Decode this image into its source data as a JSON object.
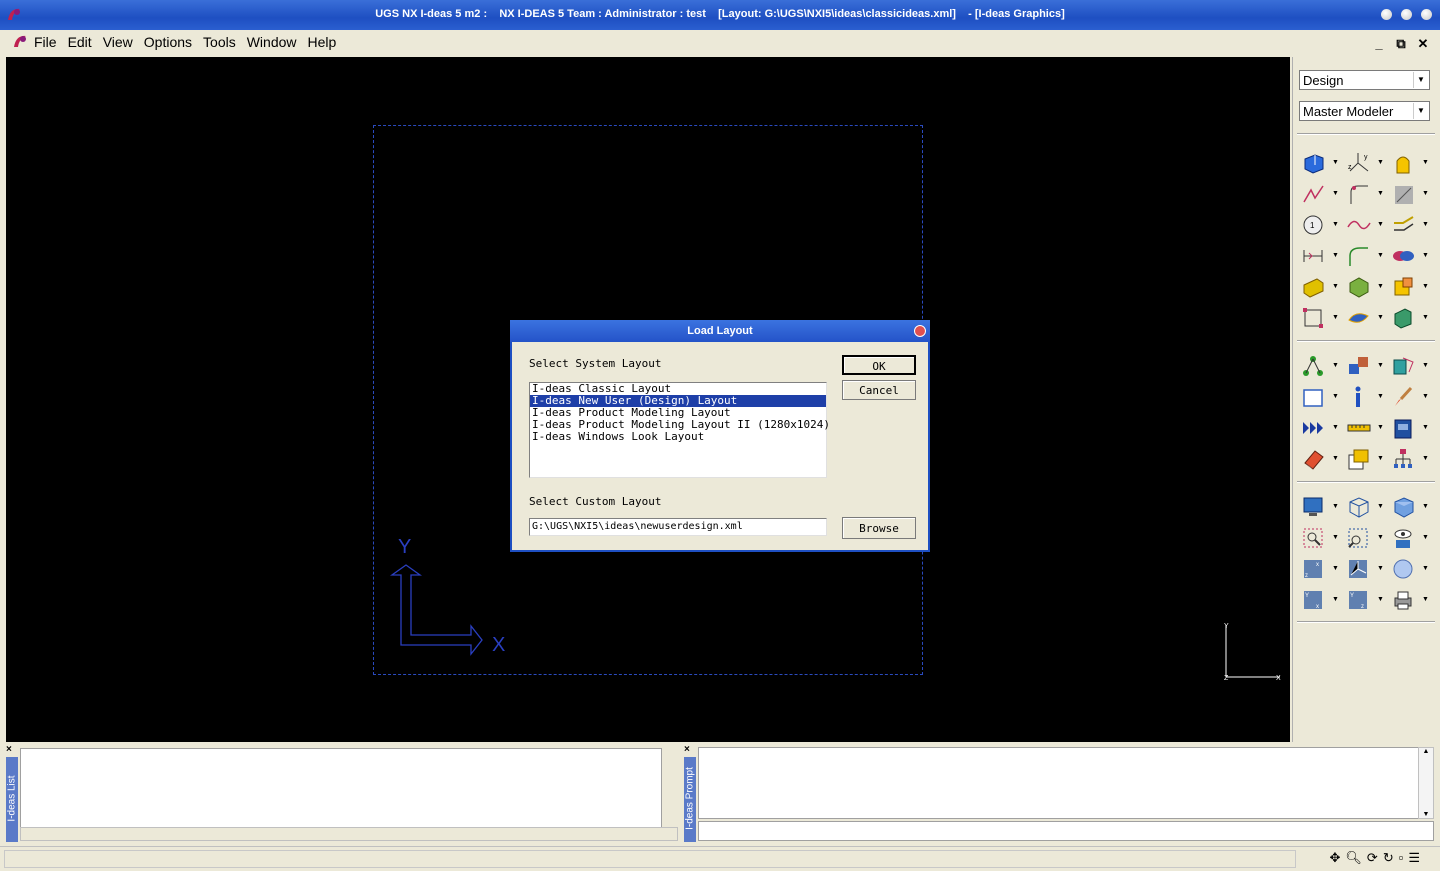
{
  "window": {
    "title": "UGS NX I-deas 5 m2 :    NX I-DEAS 5 Team : Administrator : test    [Layout: G:\\UGS\\NXI5\\ideas\\classicideas.xml]    - [I-deas Graphics]"
  },
  "menu": {
    "items": [
      "File",
      "Edit",
      "View",
      "Options",
      "Tools",
      "Window",
      "Help"
    ]
  },
  "right_panel": {
    "task_select": "Design",
    "app_select": "Master Modeler"
  },
  "triad": {
    "y_label": "Y",
    "x_label": "X"
  },
  "mini_triad": {
    "y_label": "Y",
    "x_label": "X",
    "z_label": "Z"
  },
  "bottom": {
    "list_label": "I-deas List",
    "prompt_label": "I-deas Prompt",
    "list_close": "×",
    "prompt_close": "×"
  },
  "dialog": {
    "title": "Load Layout",
    "system_label": "Select System Layout",
    "system_layouts": [
      "I-deas Classic Layout",
      "I-deas New User (Design) Layout",
      "I-deas Product Modeling Layout",
      "I-deas Product Modeling Layout II (1280x1024)",
      "I-deas Windows Look Layout"
    ],
    "selected_index": 1,
    "custom_label": "Select Custom Layout",
    "custom_path": "G:\\UGS\\NXI5\\ideas\\newuserdesign.xml",
    "ok_label": "OK",
    "cancel_label": "Cancel",
    "browse_label": "Browse"
  }
}
